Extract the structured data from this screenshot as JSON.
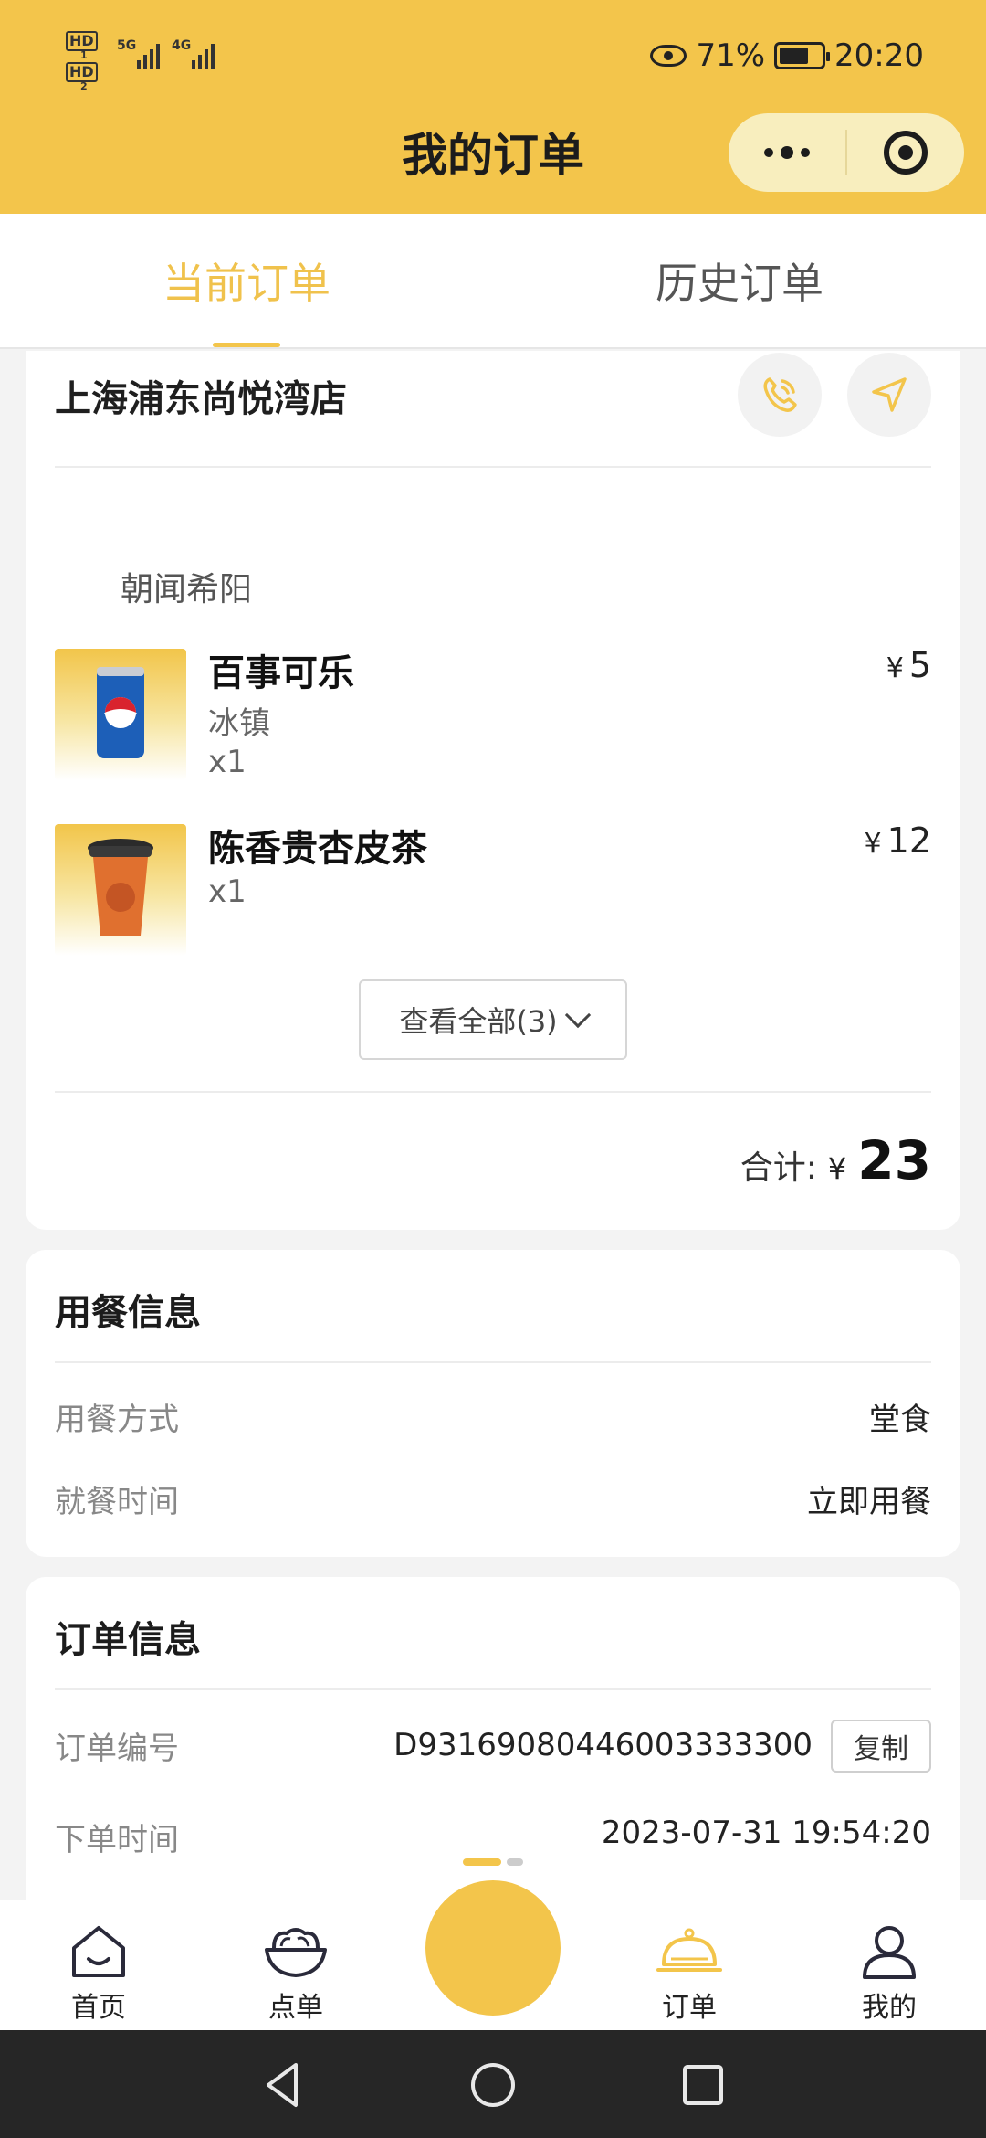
{
  "status_bar": {
    "left": {
      "hd1": "HD",
      "hd1_sub": "1",
      "hd2": "HD",
      "hd2_sub": "2",
      "net1": "5G",
      "net2": "4G"
    },
    "battery_percent": "71%",
    "battery_level": 0.71,
    "time": "20:20"
  },
  "header": {
    "title": "我的订单"
  },
  "tabs": [
    {
      "label": "当前订单",
      "active": true
    },
    {
      "label": "历史订单",
      "active": false
    }
  ],
  "order": {
    "store_name": "上海浦东尚悦湾店",
    "group_label": "朝闻希阳",
    "currency": "¥",
    "items": [
      {
        "name": "百事可乐",
        "spec": "冰镇",
        "qty": "x1",
        "price": "5",
        "image_icon": "cola-can-image"
      },
      {
        "name": "陈香贵杏皮茶",
        "spec": "",
        "qty": "x1",
        "price": "12",
        "image_icon": "tea-cup-image"
      }
    ],
    "view_all_label": "查看全部(3)",
    "total_label": "合计:",
    "total_value": "23"
  },
  "dining_info": {
    "title": "用餐信息",
    "rows": [
      {
        "label": "用餐方式",
        "value": "堂食"
      },
      {
        "label": "就餐时间",
        "value": "立即用餐"
      }
    ]
  },
  "order_info": {
    "title": "订单信息",
    "order_no_label": "订单编号",
    "order_no": "D93169080446003333300",
    "copy_label": "复制",
    "time_label": "下单时间",
    "time_value": "2023-07-31 19:54:20"
  },
  "bottom_nav": [
    {
      "label": "首页",
      "icon": "home-icon"
    },
    {
      "label": "点单",
      "icon": "noodle-bowl-icon"
    },
    {
      "label": "订单",
      "icon": "cloche-icon",
      "active": true
    },
    {
      "label": "我的",
      "icon": "user-icon"
    }
  ],
  "colors": {
    "brand": "#f3c54b",
    "active_tab": "#f0c24c"
  }
}
